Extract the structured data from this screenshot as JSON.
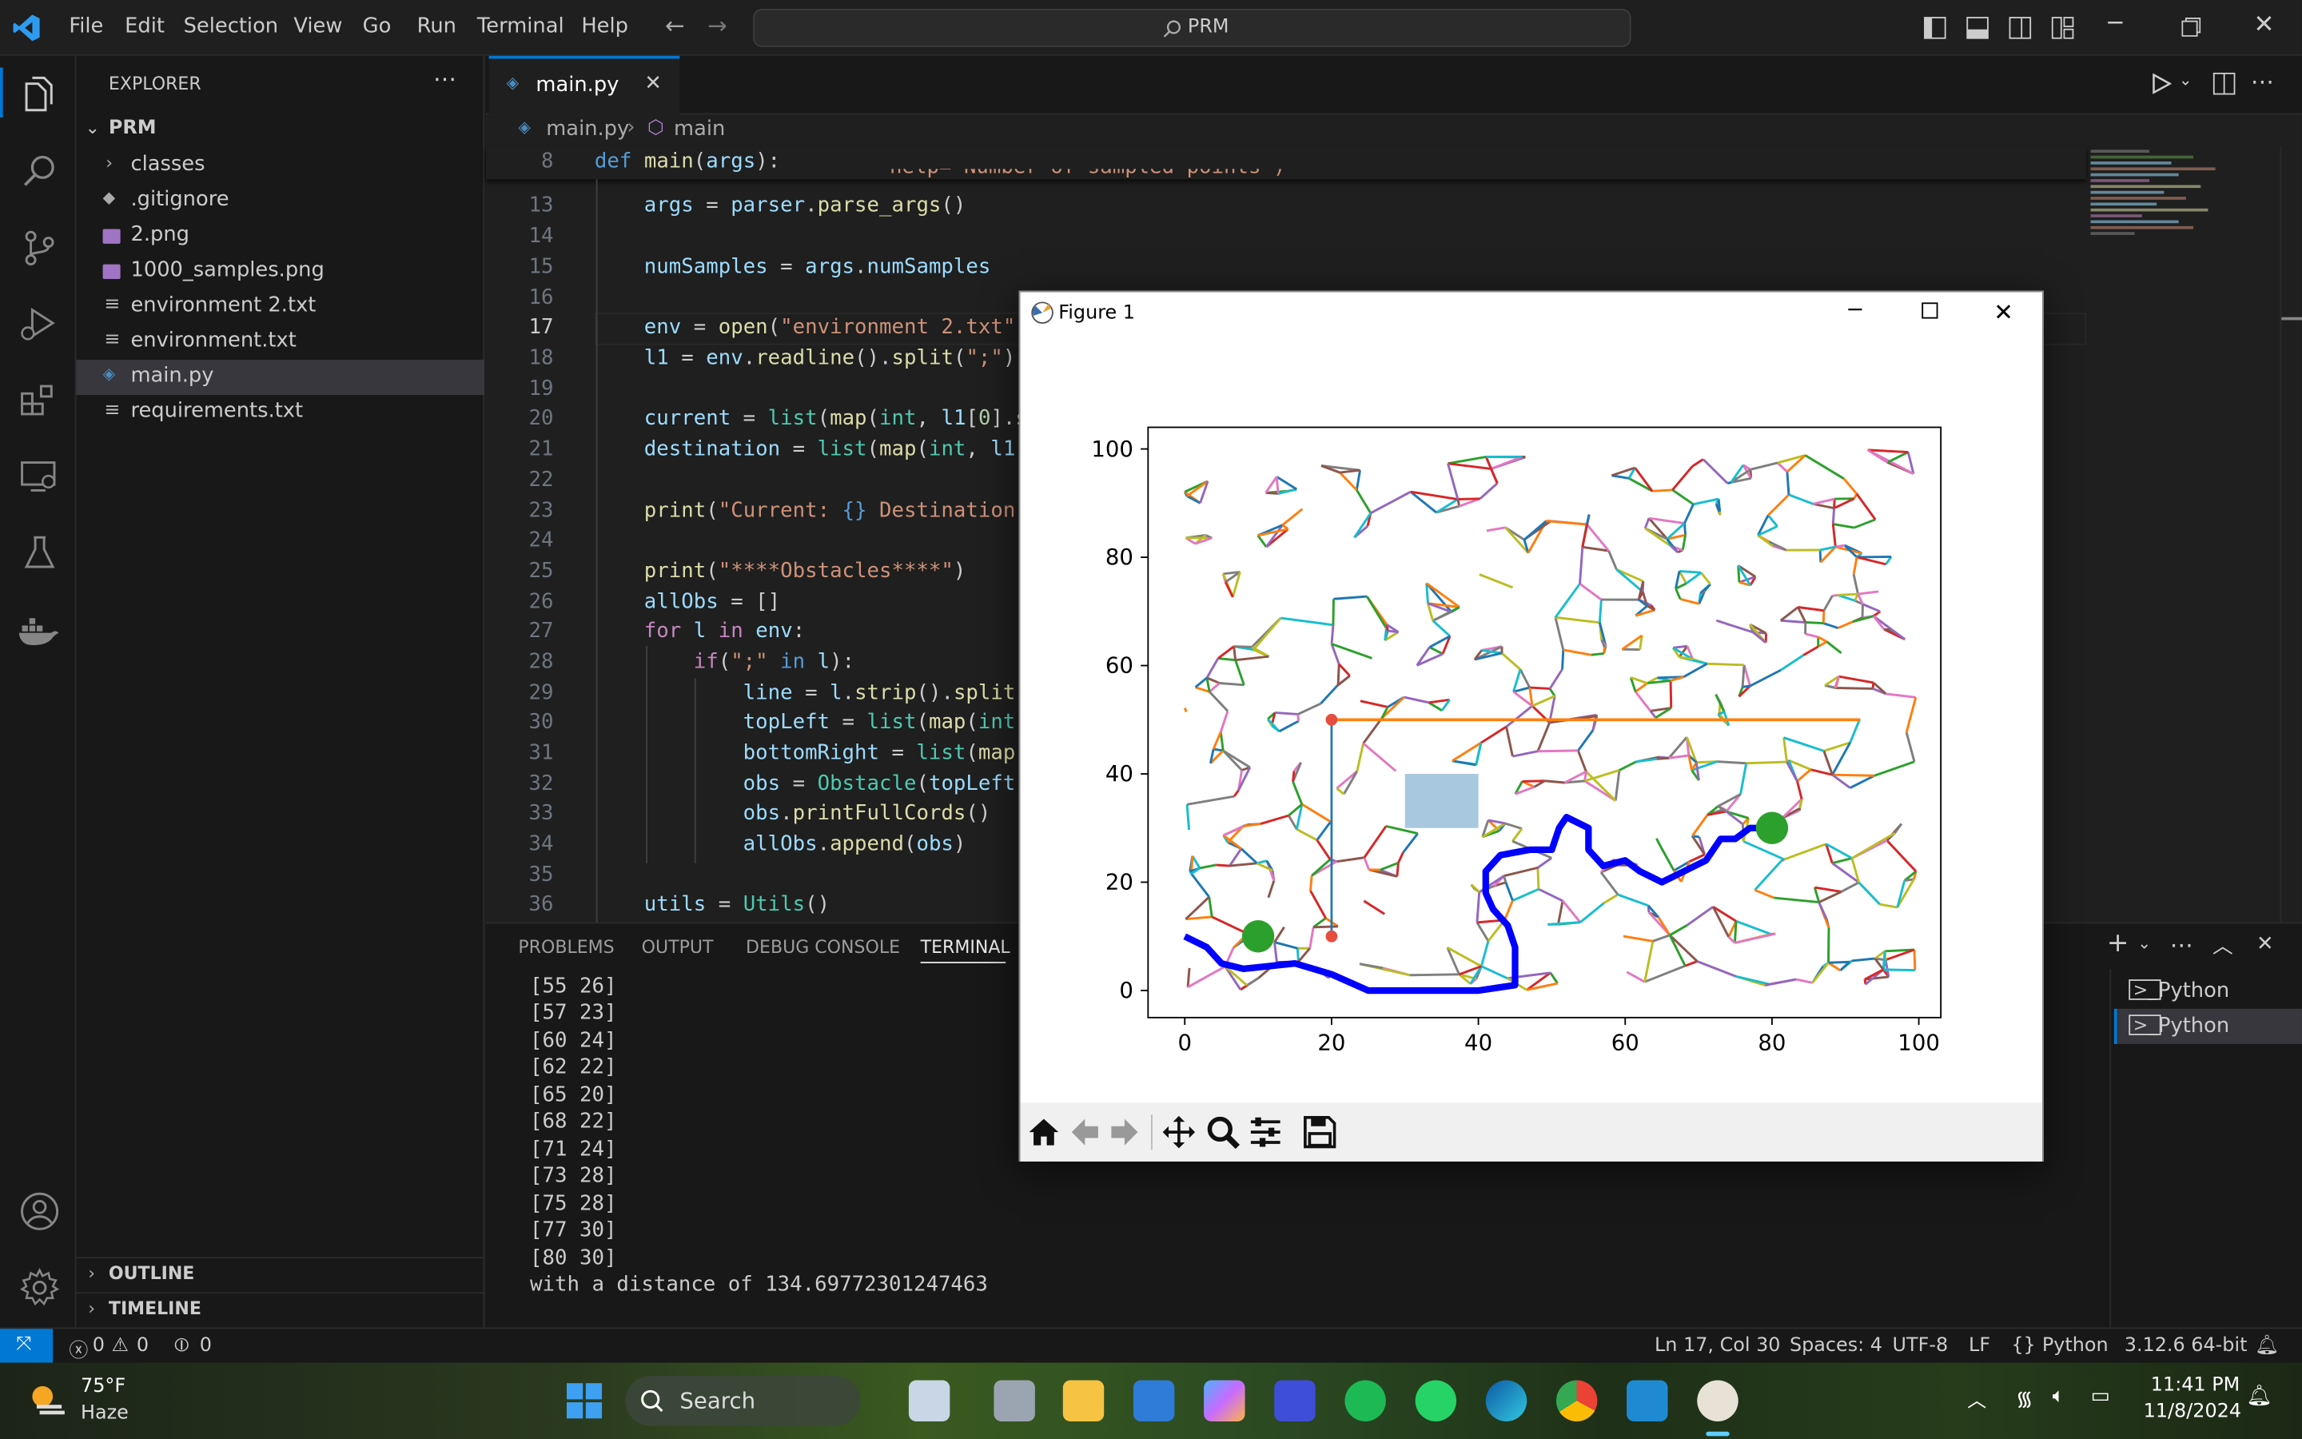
{
  "titlebar": {
    "menus": [
      "File",
      "Edit",
      "Selection",
      "View",
      "Go",
      "Run",
      "Terminal",
      "Help"
    ],
    "search": "PRM"
  },
  "sidebar": {
    "title": "EXPLORER",
    "folder": "PRM",
    "items": [
      {
        "label": "classes",
        "kind": "folder"
      },
      {
        "label": ".gitignore",
        "kind": "git"
      },
      {
        "label": "2.png",
        "kind": "image"
      },
      {
        "label": "1000_samples.png",
        "kind": "image"
      },
      {
        "label": "environment 2.txt",
        "kind": "text"
      },
      {
        "label": "environment.txt",
        "kind": "text"
      },
      {
        "label": "main.py",
        "kind": "python"
      },
      {
        "label": "requirements.txt",
        "kind": "text"
      }
    ],
    "outline": "OUTLINE",
    "timeline": "TIMELINE"
  },
  "editor": {
    "tab": "main.py",
    "breadcrumb_file": "main.py",
    "breadcrumb_symbol": "main",
    "sticky_line": "8",
    "lines": [
      "13",
      "14",
      "15",
      "16",
      "17",
      "18",
      "19",
      "20",
      "21",
      "22",
      "23",
      "24",
      "25",
      "26",
      "27",
      "28",
      "29",
      "30",
      "31",
      "32",
      "33",
      "34",
      "35",
      "36"
    ]
  },
  "panel": {
    "tabs": [
      "PROBLEMS",
      "OUTPUT",
      "DEBUG CONSOLE",
      "TERMINAL"
    ],
    "terminal_lines": [
      "[55 26]",
      "[57 23]",
      "[60 24]",
      "[62 22]",
      "[65 20]",
      "[68 22]",
      "[71 24]",
      "[73 28]",
      "[75 28]",
      "[77 30]",
      "[80 30]",
      "with a distance of 134.69772301247463"
    ],
    "terminals": [
      "Python",
      "Python"
    ]
  },
  "statusbar": {
    "errors": "0",
    "warnings": "0",
    "ports": "0",
    "position": "Ln 17, Col 30",
    "spaces": "Spaces: 4",
    "encoding": "UTF-8",
    "eol": "LF",
    "language": "Python",
    "interpreter": "3.12.6 64-bit"
  },
  "taskbar": {
    "temp": "75°F",
    "weather": "Haze",
    "search": "Search",
    "time": "11:41 PM",
    "date": "11/8/2024"
  },
  "figure": {
    "title": "Figure 1"
  },
  "chart_data": {
    "type": "scatter",
    "title": "",
    "xlabel": "",
    "ylabel": "",
    "xlim": [
      -5,
      103
    ],
    "ylim": [
      -5,
      104
    ],
    "xticks": [
      "0",
      "20",
      "40",
      "60",
      "80",
      "100"
    ],
    "yticks": [
      "0",
      "20",
      "40",
      "60",
      "80",
      "100"
    ],
    "obstacle": {
      "x0": 30,
      "y0": 30,
      "x1": 40,
      "y1": 40,
      "color": "#a8c8e0"
    },
    "start": [
      10,
      10
    ],
    "goal": [
      80,
      30
    ],
    "guide_points": [
      [
        20,
        50
      ],
      [
        20,
        10
      ]
    ],
    "path": [
      [
        0,
        10
      ],
      [
        3,
        8
      ],
      [
        5,
        5
      ],
      [
        8,
        4
      ],
      [
        15,
        5
      ],
      [
        20,
        3
      ],
      [
        25,
        0
      ],
      [
        30,
        0
      ],
      [
        40,
        0
      ],
      [
        45,
        1
      ],
      [
        45,
        8
      ],
      [
        44,
        12
      ],
      [
        42,
        15
      ],
      [
        41,
        18
      ],
      [
        41,
        22
      ],
      [
        43,
        25
      ],
      [
        47,
        26
      ],
      [
        50,
        26
      ],
      [
        51,
        30
      ],
      [
        52,
        32
      ],
      [
        55,
        30
      ],
      [
        55,
        26
      ],
      [
        57,
        23
      ],
      [
        60,
        24
      ],
      [
        62,
        22
      ],
      [
        65,
        20
      ],
      [
        68,
        22
      ],
      [
        71,
        24
      ],
      [
        73,
        28
      ],
      [
        75,
        28
      ],
      [
        77,
        30
      ],
      [
        80,
        30
      ]
    ],
    "path_color": "#0000ff",
    "edge_colors": [
      "#1f77b4",
      "#ff7f0e",
      "#2ca02c",
      "#d62728",
      "#9467bd",
      "#8c564b",
      "#e377c2",
      "#7f7f7f",
      "#bcbd22",
      "#17becf"
    ]
  }
}
